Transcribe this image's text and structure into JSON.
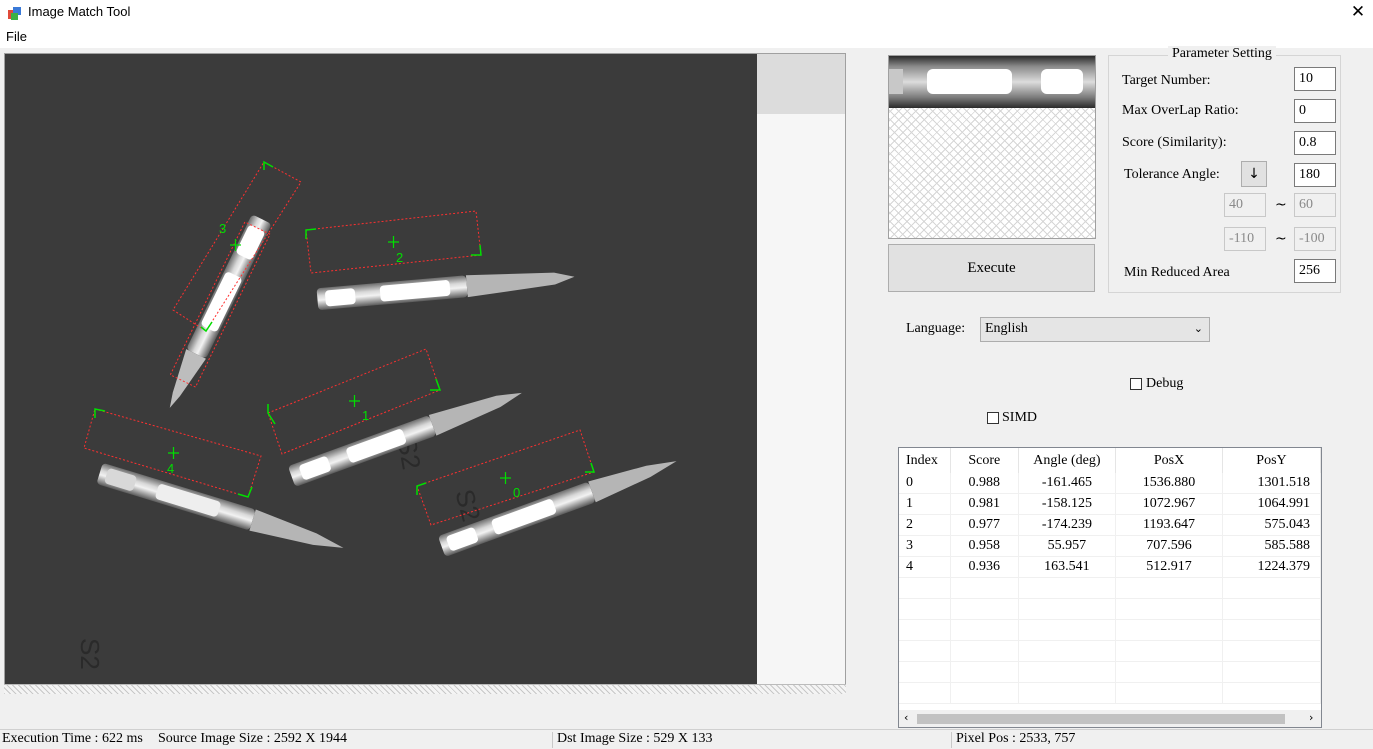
{
  "window": {
    "title": "Image Match Tool",
    "close_glyph": "✕",
    "icon": "app-icon"
  },
  "menu": {
    "file": "File"
  },
  "source_image": {
    "description_icon": "image-canvas",
    "matches": [
      {
        "label": "3"
      },
      {
        "label": "2"
      },
      {
        "label": "1"
      },
      {
        "label": "4"
      },
      {
        "label": "0"
      }
    ],
    "paper_marks": [
      "S2",
      "S2",
      "S2",
      "S2"
    ]
  },
  "execute_label": "Execute",
  "params": {
    "legend": "Parameter Setting",
    "target_number_label": "Target Number:",
    "target_number": "10",
    "max_overlap_label": "Max OverLap Ratio:",
    "max_overlap": "0",
    "score_label": "Score (Similarity):",
    "score": "0.8",
    "tolerance_angle_label": "Tolerance Angle:",
    "tolerance_angle": "180",
    "toggle_glyph": "↓",
    "range1_from": "40",
    "range1_to": "60",
    "range2_from": "-110",
    "range2_to": "-100",
    "tilde": "~",
    "min_reduced_area_label": "Min Reduced Area",
    "min_reduced_area": "256"
  },
  "language": {
    "label": "Language:",
    "value": "English"
  },
  "debug_label": "Debug",
  "simd_label": "SIMD",
  "table": {
    "columns": [
      "Index",
      "Score",
      "Angle (deg)",
      "PosX",
      "PosY"
    ],
    "rows": [
      [
        "0",
        "0.988",
        "-161.465",
        "1536.880",
        "1301.518"
      ],
      [
        "1",
        "0.981",
        "-158.125",
        "1072.967",
        "1064.991"
      ],
      [
        "2",
        "0.977",
        "-174.239",
        "1193.647",
        "575.043"
      ],
      [
        "3",
        "0.958",
        "55.957",
        "707.596",
        "585.588"
      ],
      [
        "4",
        "0.936",
        "163.541",
        "512.917",
        "1224.379"
      ]
    ]
  },
  "status": {
    "execution_time": "Execution Time : 622 ms",
    "source_size": "Source Image Size : 2592 X 1944",
    "dst_size": "Dst Image Size : 529 X 133",
    "pixel_pos": "Pixel Pos : 2533, 757"
  },
  "colors": {
    "match_green": "#00e000",
    "match_red": "#ff3030",
    "photo_bg": "#3a3a3a"
  }
}
